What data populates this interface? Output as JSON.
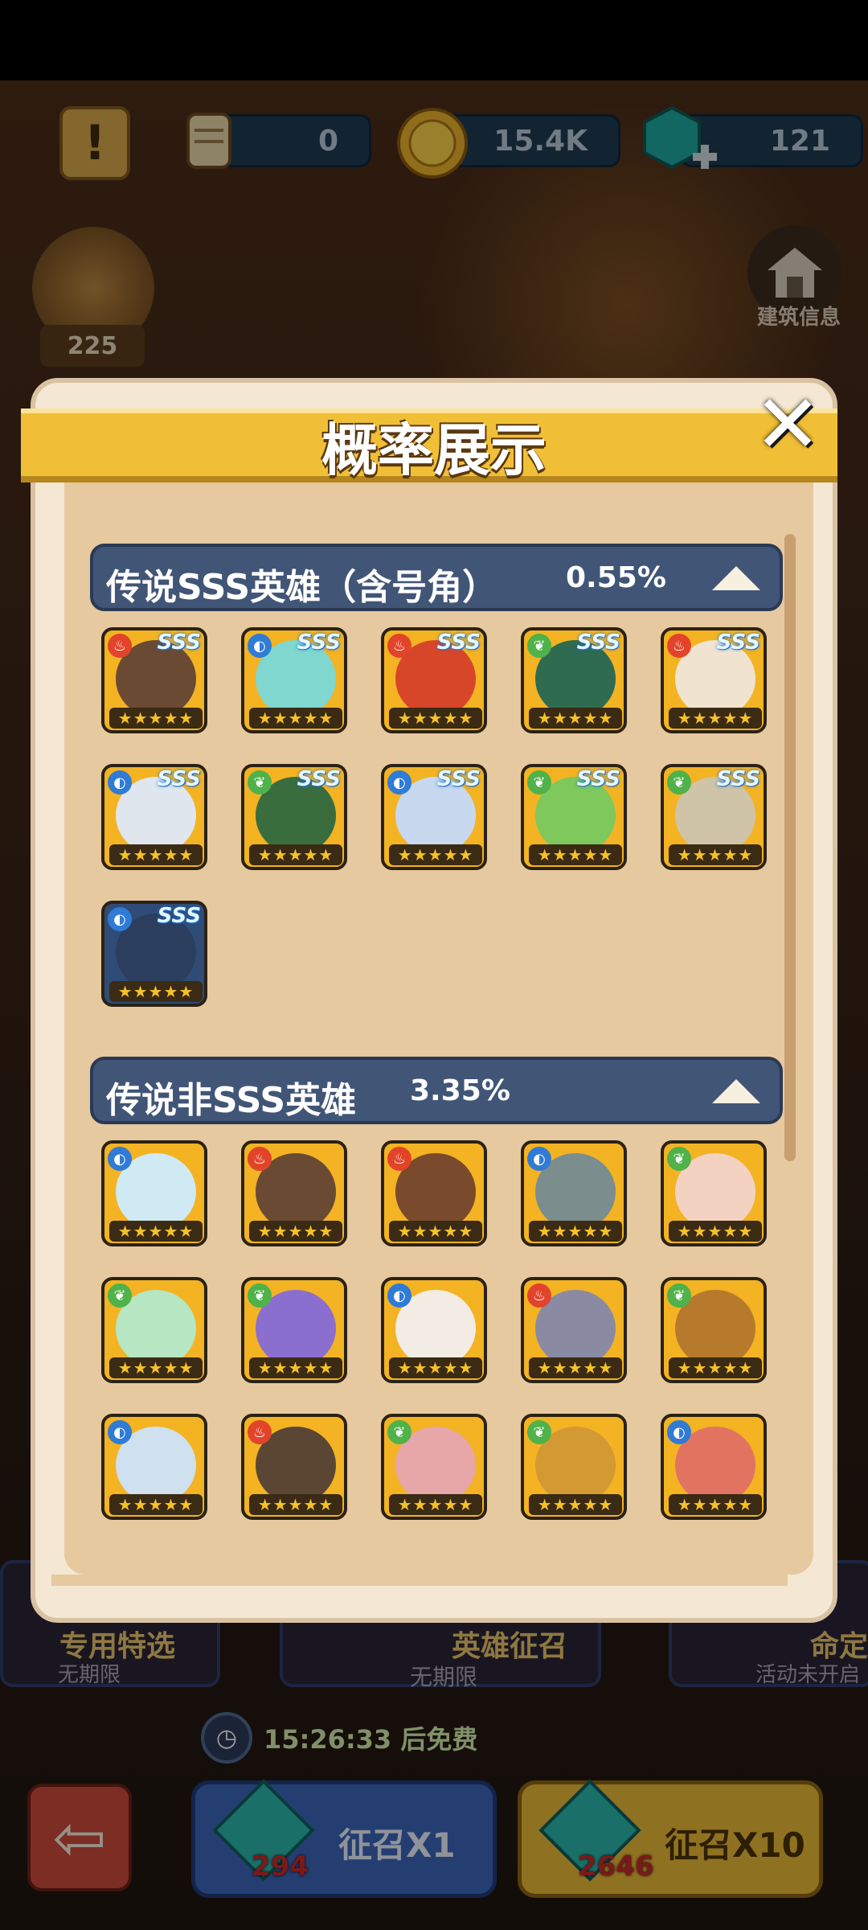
{
  "resources": {
    "scroll": "0",
    "gold": "15.4K",
    "gems": "121",
    "horn_count": "225"
  },
  "building_info_label": "建筑信息",
  "background": {
    "left_card_label": "专用特选",
    "left_card_sub": "无期限",
    "center_card_label": "英雄征召",
    "center_card_sub": "无期限",
    "right_card_label": "命定",
    "right_card_sub": "活动未开启",
    "timer_text": "15:26:33 后免费"
  },
  "buttons": {
    "recruit_x1": {
      "label": "征召X1",
      "cost": "294"
    },
    "recruit_x10": {
      "label": "征召X10",
      "cost": "2646"
    }
  },
  "modal": {
    "title": "概率展示",
    "sections": [
      {
        "title": "传说SSS英雄（含号角）",
        "rate": "0.55%",
        "cards": [
          {
            "elem": "fire",
            "bg": "#f3b323",
            "face": "#6b4a34"
          },
          {
            "elem": "water",
            "bg": "#f3b323",
            "face": "#7fd7cf"
          },
          {
            "elem": "fire",
            "bg": "#f3b323",
            "face": "#d8462a"
          },
          {
            "elem": "leaf",
            "bg": "#f3b323",
            "face": "#2f6b50"
          },
          {
            "elem": "fire",
            "bg": "#f3b323",
            "face": "#f0e4d0"
          },
          {
            "elem": "water",
            "bg": "#f3b323",
            "face": "#dfe6ee"
          },
          {
            "elem": "leaf",
            "bg": "#f3b323",
            "face": "#3a6d3e"
          },
          {
            "elem": "water",
            "bg": "#f3b323",
            "face": "#c7d8ef"
          },
          {
            "elem": "leaf",
            "bg": "#f3b323",
            "face": "#7ec85c"
          },
          {
            "elem": "leaf",
            "bg": "#f3b323",
            "face": "#cfc3a8"
          },
          {
            "elem": "water",
            "bg": "#2f4c76",
            "face": "#2b3e5e"
          }
        ]
      },
      {
        "title": "传说非SSS英雄",
        "rate": "3.35%",
        "cards": [
          {
            "elem": "water",
            "bg": "#f3b323",
            "face": "#cfeaf3"
          },
          {
            "elem": "fire",
            "bg": "#f3b323",
            "face": "#6b4a34"
          },
          {
            "elem": "fire",
            "bg": "#f3b323",
            "face": "#7a4a2c"
          },
          {
            "elem": "water",
            "bg": "#f3b323",
            "face": "#7b8d8c"
          },
          {
            "elem": "leaf",
            "bg": "#f3b323",
            "face": "#f3d2c2"
          },
          {
            "elem": "leaf",
            "bg": "#f3b323",
            "face": "#b7e6c2"
          },
          {
            "elem": "leaf",
            "bg": "#f3b323",
            "face": "#8b6fcf"
          },
          {
            "elem": "water",
            "bg": "#f3b323",
            "face": "#f2ece4"
          },
          {
            "elem": "fire",
            "bg": "#f3b323",
            "face": "#8a8aa3"
          },
          {
            "elem": "leaf",
            "bg": "#f3b323",
            "face": "#b77a2c"
          },
          {
            "elem": "water",
            "bg": "#f3b323",
            "face": "#cfe0ef"
          },
          {
            "elem": "fire",
            "bg": "#f3b323",
            "face": "#5b4633"
          },
          {
            "elem": "leaf",
            "bg": "#f3b323",
            "face": "#e7a6a8"
          },
          {
            "elem": "leaf",
            "bg": "#f3b323",
            "face": "#d39a34"
          },
          {
            "elem": "water",
            "bg": "#f3b323",
            "face": "#e37361"
          }
        ]
      }
    ],
    "stars": "★★★★★",
    "grade_label": "SSS"
  }
}
